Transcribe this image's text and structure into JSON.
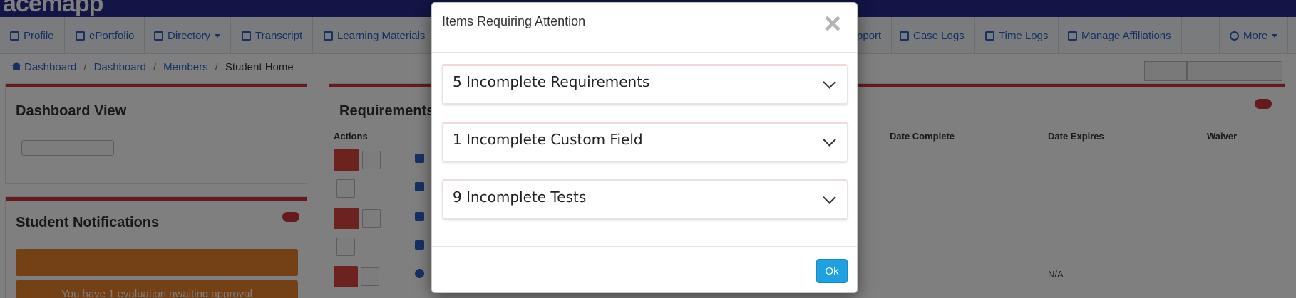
{
  "app": {
    "logo_text": "acemapp"
  },
  "nav": {
    "items": [
      {
        "label": "Profile",
        "icon": "pencil-icon"
      },
      {
        "label": "ePortfolio",
        "icon": "rocket-icon"
      },
      {
        "label": "Directory",
        "icon": "sitemap-icon"
      },
      {
        "label": "Transcript",
        "icon": "document-icon"
      },
      {
        "label": "Learning Materials",
        "icon": "graduation-cap-icon"
      }
    ],
    "right_items": [
      {
        "label": "pport",
        "icon": ""
      },
      {
        "label": "Case Logs",
        "icon": "briefcase-icon"
      },
      {
        "label": "Time Logs",
        "icon": "clock-icon"
      },
      {
        "label": "Manage Affiliations",
        "icon": "link-icon"
      },
      {
        "label": "More",
        "icon": "gear-icon"
      }
    ]
  },
  "breadcrumb": [
    "Dashboard",
    "Dashboard",
    "Members",
    "Student Home"
  ],
  "background": {
    "left_panel_title": "Dashboard View",
    "notifications_title": "Student Notifications",
    "evaluation_notice": "You have 1 evaluation awaiting approval",
    "req_panel_title": "Requirements",
    "columns": [
      "Actions",
      "Date Complete",
      "Date Expires",
      "Waiver"
    ],
    "visible_row": {
      "date_complete": "---",
      "date_expires": "N/A",
      "waiver": "---"
    }
  },
  "modal": {
    "title": "Items Requiring Attention",
    "close_symbol": "×",
    "sections": [
      {
        "label": "5 Incomplete Requirements"
      },
      {
        "label": "1 Incomplete Custom Field"
      },
      {
        "label": "9 Incomplete Tests"
      }
    ],
    "ok_label": "Ok"
  },
  "colors": {
    "accent_red": "#c9373d",
    "ok_button": "#1ea1e1",
    "nav_link": "#2a62c8",
    "notice_orange": "#e8812c"
  }
}
